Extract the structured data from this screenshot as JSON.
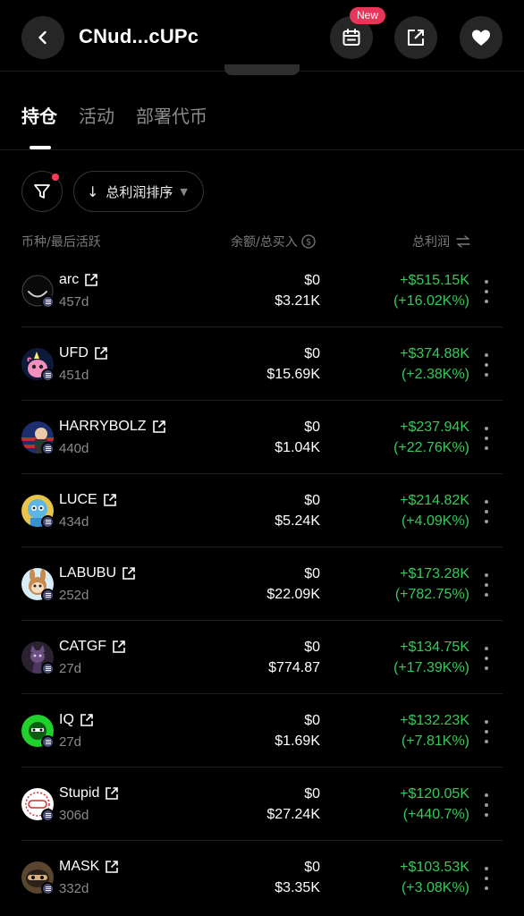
{
  "header": {
    "title": "CNud...cUPc",
    "new_badge": "New"
  },
  "tabs": [
    {
      "label": "持仓",
      "active": true
    },
    {
      "label": "活动",
      "active": false
    },
    {
      "label": "部署代币",
      "active": false
    }
  ],
  "filters": {
    "sort_label": "总利润排序"
  },
  "columns": {
    "token": "币种/最后活跃",
    "balance": "余额/总买入",
    "pnl": "总利润"
  },
  "colors": {
    "background": "#000000",
    "profit": "#37c95a",
    "badge": "#e8365a"
  },
  "holdings": [
    {
      "symbol": "arc",
      "age": "457d",
      "balance": "$0",
      "bought": "$3.21K",
      "pnl": "+$515.15K",
      "pct": "(+16.02K%)",
      "avatar": "arc-logo"
    },
    {
      "symbol": "UFD",
      "age": "451d",
      "balance": "$0",
      "bought": "$15.69K",
      "pnl": "+$374.88K",
      "pct": "(+2.38K%)",
      "avatar": "pink-unicorn"
    },
    {
      "symbol": "HARRYBOLZ",
      "age": "440d",
      "balance": "$0",
      "bought": "$1.04K",
      "pnl": "+$237.94K",
      "pct": "(+22.76K%)",
      "avatar": "flag-figure"
    },
    {
      "symbol": "LUCE",
      "age": "434d",
      "balance": "$0",
      "bought": "$5.24K",
      "pnl": "+$214.82K",
      "pct": "(+4.09K%)",
      "avatar": "mascot"
    },
    {
      "symbol": "LABUBU",
      "age": "252d",
      "balance": "$0",
      "bought": "$22.09K",
      "pnl": "+$173.28K",
      "pct": "(+782.75%)",
      "avatar": "labubu-toy"
    },
    {
      "symbol": "CATGF",
      "age": "27d",
      "balance": "$0",
      "bought": "$774.87",
      "pnl": "+$134.75K",
      "pct": "(+17.39K%)",
      "avatar": "dark-cat"
    },
    {
      "symbol": "IQ",
      "age": "27d",
      "balance": "$0",
      "bought": "$1.69K",
      "pnl": "+$132.23K",
      "pct": "(+7.81K%)",
      "avatar": "green-face"
    },
    {
      "symbol": "Stupid",
      "age": "306d",
      "balance": "$0",
      "bought": "$27.24K",
      "pnl": "+$120.05K",
      "pct": "(+440.7%)",
      "avatar": "stupid-stamp"
    },
    {
      "symbol": "MASK",
      "age": "332d",
      "balance": "$0",
      "bought": "$3.35K",
      "pnl": "+$103.53K",
      "pct": "(+3.08K%)",
      "avatar": "mask-face"
    }
  ]
}
